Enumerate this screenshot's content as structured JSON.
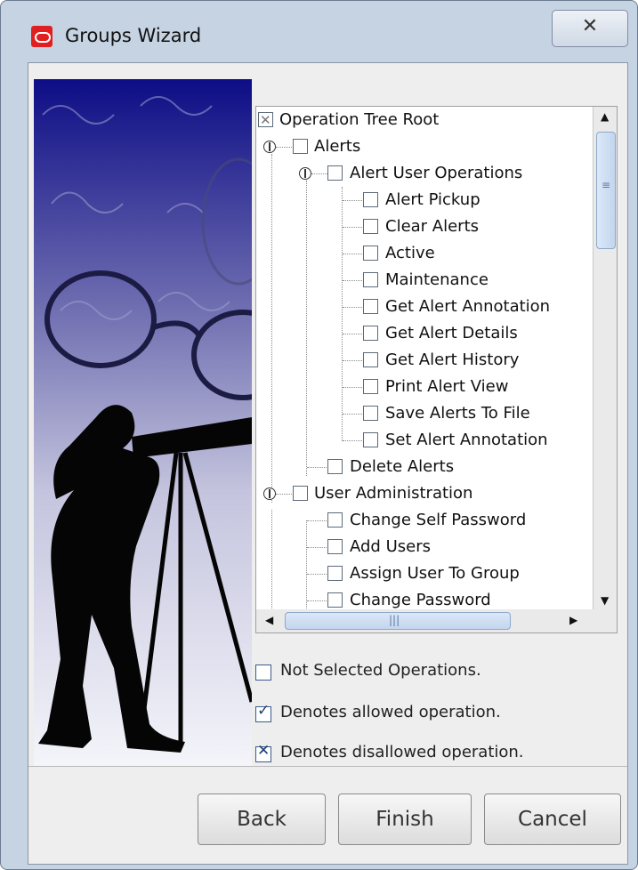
{
  "window": {
    "title": "Groups Wizard",
    "close_glyph": "✕"
  },
  "tree": {
    "root": "Operation Tree Root",
    "alerts": "Alerts",
    "alert_user_ops": "Alert User Operations",
    "alert_children": [
      "Alert Pickup",
      "Clear Alerts",
      "Active",
      "Maintenance",
      "Get Alert Annotation",
      "Get Alert Details",
      "Get Alert History",
      "Print Alert View",
      "Save Alerts To File",
      "Set Alert Annotation"
    ],
    "delete_alerts": "Delete Alerts",
    "user_admin": "User Administration",
    "user_admin_children": [
      "Change Self Password",
      "Add Users",
      "Assign User To Group",
      "Change Password"
    ]
  },
  "legend": {
    "not_selected": "Not Selected Operations.",
    "allowed": "Denotes allowed operation.",
    "disallowed": "Denotes disallowed operation."
  },
  "buttons": {
    "back": "Back",
    "finish": "Finish",
    "cancel": "Cancel"
  },
  "colors": {
    "accent": "#e02020",
    "art_blue": "#1a1a8c"
  },
  "icons": {
    "app": "oracle-logo-icon",
    "scroll_up": "▲",
    "scroll_down": "▼",
    "scroll_left": "◀",
    "scroll_right": "▶",
    "thumb_grip": "≡",
    "hthumb_grip": "|||"
  }
}
